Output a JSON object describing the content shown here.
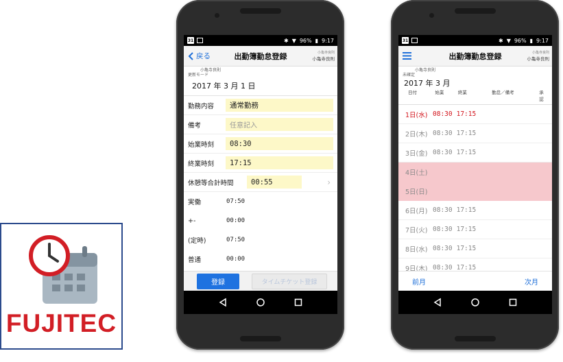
{
  "brand": {
    "name": "FUJITEC",
    "color": "#d21e25"
  },
  "status_bar": {
    "battery": "96%",
    "time": "9:17",
    "calendar_badge": "31"
  },
  "screen1": {
    "back_label": "戻る",
    "title": "出勤簿勤怠登録",
    "user": "小亀寺良則",
    "user_top": "小亀寺良則",
    "mode": "更新モード",
    "date": "2017 年 3 月 1 日",
    "fields": {
      "work_type_label": "勤務内容",
      "work_type_value": "通常勤務",
      "remarks_label": "備考",
      "remarks_placeholder": "任意記入",
      "start_label": "始業時刻",
      "start_value": "08:30",
      "end_label": "終業時刻",
      "end_value": "17:15",
      "break_label": "休憩等合計時間",
      "break_value": "00:55"
    },
    "stats": [
      {
        "label": "実働",
        "value": "07:50"
      },
      {
        "label": "+-",
        "value": "00:00"
      },
      {
        "label": "(定時)",
        "value": "07:50"
      },
      {
        "label": "普通",
        "value": "00:00"
      }
    ],
    "register_button": "登録",
    "timeticket_button": "タイムチケット登録"
  },
  "screen2": {
    "title": "出勤簿勤怠登録",
    "user": "小亀寺良則",
    "user_top": "小亀寺良則",
    "state": "未確定",
    "month": "2017 年 3 月",
    "columns": {
      "day": "日付",
      "start": "始業",
      "end": "終業",
      "break": "勤怠／備考",
      "approve": "承認"
    },
    "days": [
      {
        "day": "1日(水)",
        "start": "08:30",
        "end": "17:15",
        "kind": "today"
      },
      {
        "day": "2日(木)",
        "start": "08:30",
        "end": "17:15",
        "kind": "normal"
      },
      {
        "day": "3日(金)",
        "start": "08:30",
        "end": "17:15",
        "kind": "normal"
      },
      {
        "day": "4日(土)",
        "start": "",
        "end": "",
        "kind": "holiday"
      },
      {
        "day": "5日(日)",
        "start": "",
        "end": "",
        "kind": "holiday"
      },
      {
        "day": "6日(月)",
        "start": "08:30",
        "end": "17:15",
        "kind": "normal"
      },
      {
        "day": "7日(火)",
        "start": "08:30",
        "end": "17:15",
        "kind": "normal"
      },
      {
        "day": "8日(水)",
        "start": "08:30",
        "end": "17:15",
        "kind": "normal"
      },
      {
        "day": "9日(木)",
        "start": "08:30",
        "end": "17:15",
        "kind": "normal"
      }
    ],
    "prev_month": "前月",
    "next_month": "次月"
  },
  "icons": [
    "clock-calendar-icon",
    "back-chevron-icon",
    "hamburger-menu-icon",
    "chevron-right-icon",
    "back-triangle-icon",
    "home-circle-icon",
    "recents-square-icon",
    "bluetooth-icon",
    "wifi-icon",
    "signal-icon",
    "battery-icon"
  ],
  "colors": {
    "accent": "#1e72e0",
    "highlight_field": "#fdf8c8",
    "holiday_row": "#f6c8cc",
    "today_text": "#d2121a"
  }
}
